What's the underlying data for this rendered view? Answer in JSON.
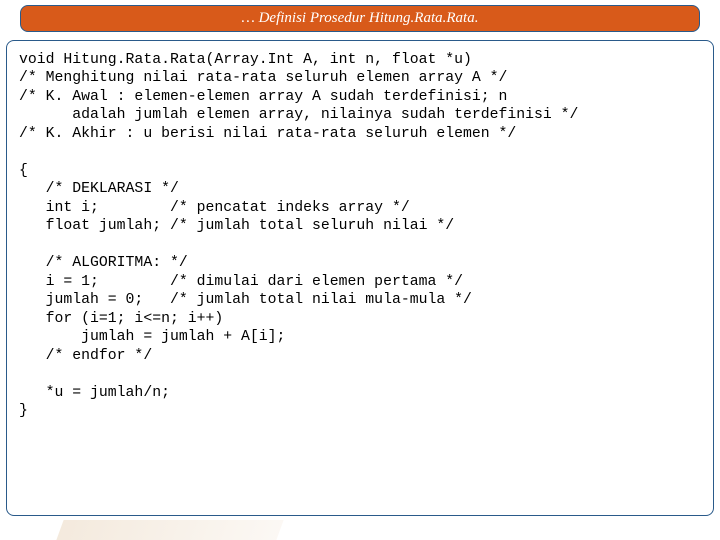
{
  "header": {
    "title": "… Definisi Prosedur Hitung.Rata.Rata."
  },
  "code": {
    "line01": "void Hitung.Rata.Rata(Array.Int A, int n, float *u)",
    "line02": "/* Menghitung nilai rata-rata seluruh elemen array A */",
    "line03": "/* K. Awal : elemen-elemen array A sudah terdefinisi; n",
    "line04": "      adalah jumlah elemen array, nilainya sudah terdefinisi */",
    "line05": "/* K. Akhir : u berisi nilai rata-rata seluruh elemen */",
    "line06": "",
    "line07": "{",
    "line08": "   /* DEKLARASI */",
    "line09": "   int i;        /* pencatat indeks array */",
    "line10": "   float jumlah; /* jumlah total seluruh nilai */",
    "line11": "",
    "line12": "   /* ALGORITMA: */",
    "line13": "   i = 1;        /* dimulai dari elemen pertama */",
    "line14": "   jumlah = 0;   /* jumlah total nilai mula-mula */",
    "line15": "   for (i=1; i<=n; i++)",
    "line16": "       jumlah = jumlah + A[i];",
    "line17": "   /* endfor */",
    "line18": "",
    "line19": "   *u = jumlah/n;",
    "line20": "}"
  }
}
